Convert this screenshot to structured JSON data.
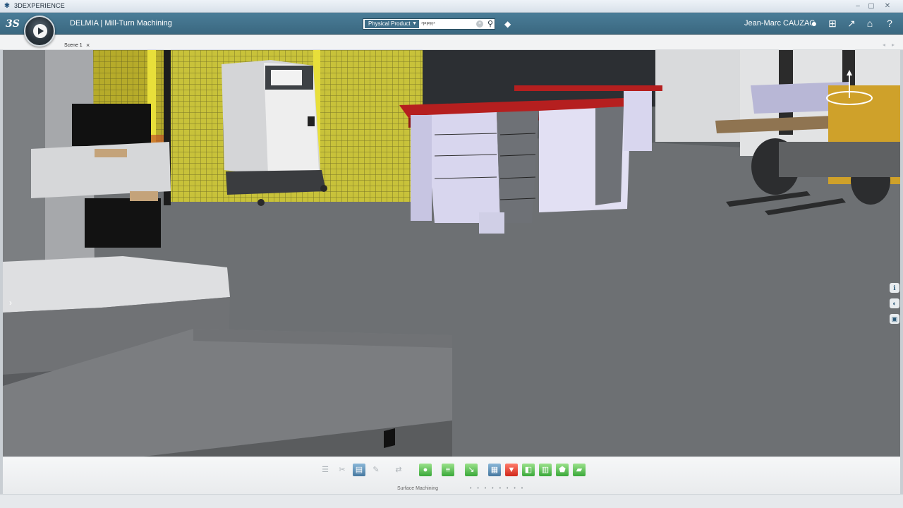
{
  "window": {
    "title": "3DEXPERIENCE"
  },
  "header": {
    "app_title": "DELMIA | Mill-Turn Machining",
    "search": {
      "scope": "Physical Product",
      "value": "*PPR*"
    },
    "user_name": "Jean-Marc CAUZAC"
  },
  "tabs": [
    {
      "label": "Scene 1"
    }
  ],
  "action_bar": {
    "section_label": "Surface Machining"
  },
  "colors": {
    "header": "#3f6f88",
    "accent": "#d0281b",
    "floor": "#6a6d70"
  }
}
